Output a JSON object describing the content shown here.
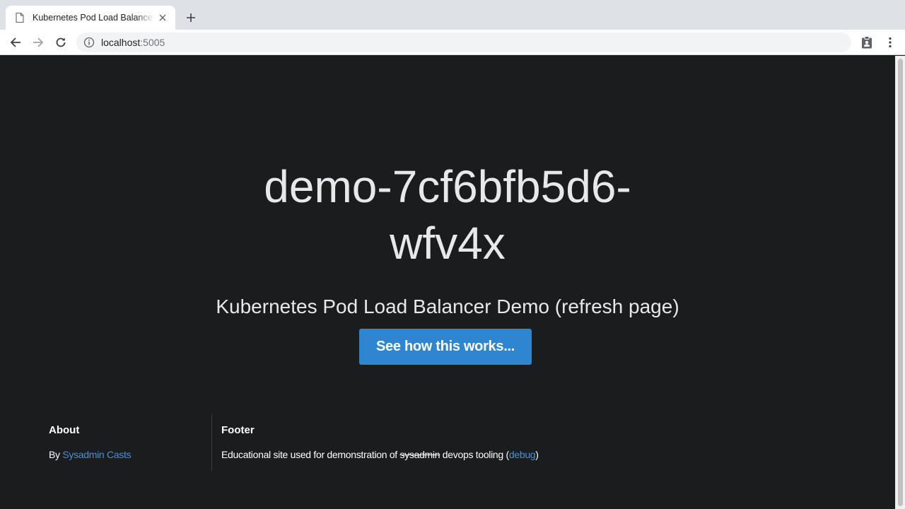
{
  "browser": {
    "tab_title": "Kubernetes Pod Load Balancer Demo",
    "url_host": "localhost",
    "url_port": ":5005"
  },
  "hero": {
    "title": "demo-7cf6bfb5d6-wfv4x",
    "subtitle": "Kubernetes Pod Load Balancer Demo (refresh page)",
    "button_label": "See how this works..."
  },
  "footer": {
    "about": {
      "heading": "About",
      "by_prefix": "By ",
      "author_link": "Sysadmin Casts"
    },
    "main": {
      "heading": "Footer",
      "text_prefix": "Educational site used for demonstration of ",
      "struck_word": "sysadmin",
      "text_middle": " devops tooling (",
      "debug_link": "debug",
      "text_suffix": ")"
    }
  },
  "colors": {
    "page_background": "#1b1c1d",
    "button": "#2d86cf",
    "link": "#4a90d9"
  }
}
